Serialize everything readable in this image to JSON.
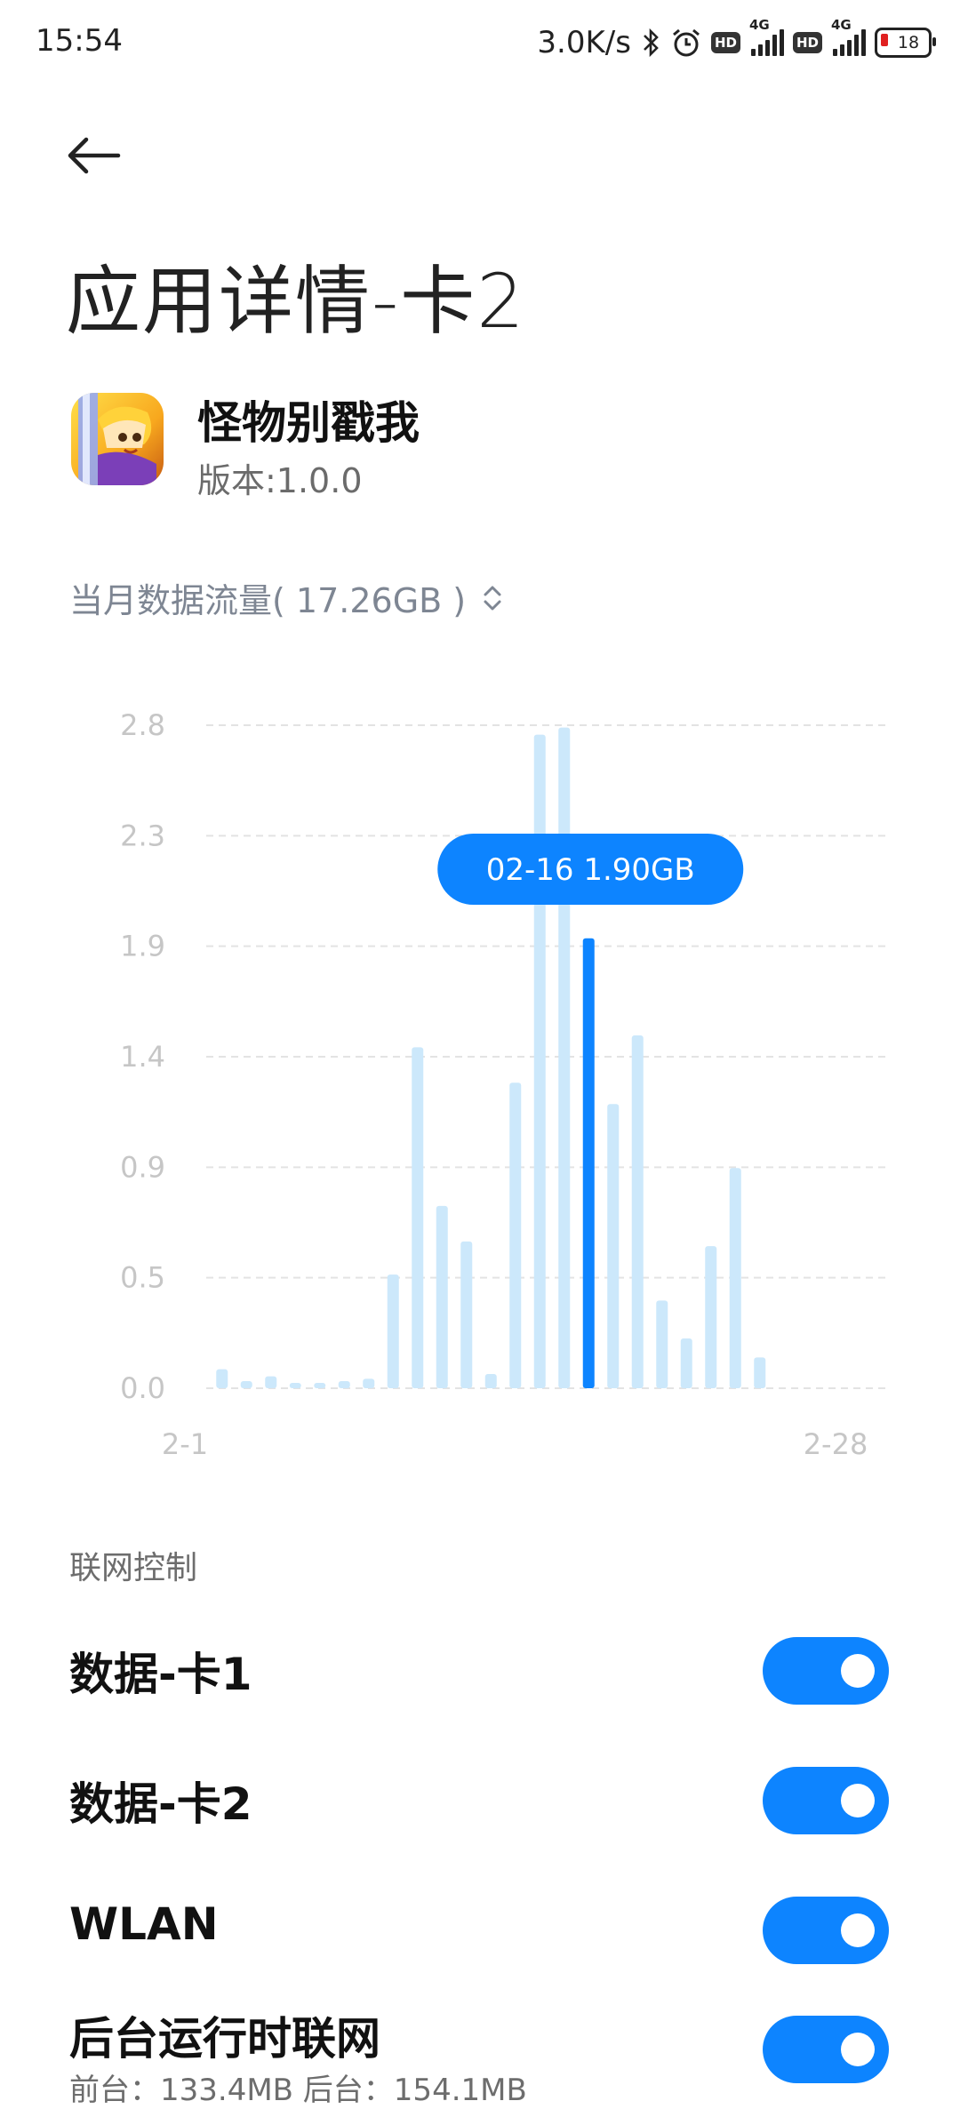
{
  "status_bar": {
    "time": "15:54",
    "speed": "3.0K/s",
    "network1": "4G",
    "network2": "4G",
    "hd": "HD",
    "battery": "18"
  },
  "header": {
    "title": "应用详情-卡2"
  },
  "app": {
    "name": "怪物别戳我",
    "version": "版本:1.0.0"
  },
  "usage": {
    "label": "当月数据流量( 17.26GB )"
  },
  "chart_data": {
    "type": "bar",
    "x_start_label": "2-1",
    "x_end_label": "2-28",
    "yticks": [
      "2.8",
      "2.3",
      "1.9",
      "1.4",
      "0.9",
      "0.5",
      "0.0"
    ],
    "ylim": [
      0,
      2.8
    ],
    "days": 28,
    "values": [
      0.08,
      0.03,
      0.05,
      0.02,
      0.02,
      0.03,
      0.04,
      0.48,
      1.44,
      0.77,
      0.62,
      0.06,
      1.29,
      2.76,
      2.79,
      1.9,
      1.2,
      1.49,
      0.37,
      0.21,
      0.6,
      0.93,
      0.13,
      0,
      0,
      0,
      0,
      0
    ],
    "selected_index": 15,
    "tooltip": "02-16 1.90GB",
    "color_selected": "#0d84ff",
    "color_normal": "#cce8fb"
  },
  "network_control": {
    "title": "联网控制",
    "items": [
      {
        "label": "数据-卡1",
        "on": true
      },
      {
        "label": "数据-卡2",
        "on": true
      },
      {
        "label": "WLAN",
        "on": true
      },
      {
        "label": "后台运行时联网",
        "on": true,
        "sub": "前台：133.4MB  后台：154.1MB"
      }
    ]
  }
}
